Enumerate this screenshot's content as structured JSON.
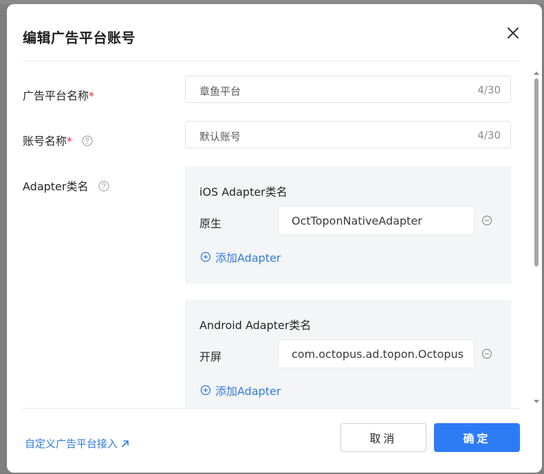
{
  "dialog": {
    "title": "编辑广告平台账号"
  },
  "form": {
    "platform_name": {
      "label": "广告平台名称",
      "required_mark": "*",
      "value": "章鱼平台",
      "counter": "4/30"
    },
    "account_name": {
      "label": "账号名称",
      "required_mark": "*",
      "value": "默认账号",
      "counter": "4/30"
    },
    "adapter": {
      "label": "Adapter类名"
    }
  },
  "ios_panel": {
    "title": "iOS Adapter类名",
    "rows": [
      {
        "label": "原生",
        "value": "OctToponNativeAdapter"
      }
    ],
    "add_label": "添加Adapter"
  },
  "android_panel": {
    "title": "Android Adapter类名",
    "rows": [
      {
        "label": "开屏",
        "value": "com.octopus.ad.topon.OctopusAdapter"
      }
    ],
    "add_label": "添加Adapter"
  },
  "footer": {
    "custom_link": "自定义广告平台接入",
    "cancel_label": "取消",
    "ok_label": "确定"
  },
  "colors": {
    "primary": "#2d7cf6",
    "link": "#2f7be0",
    "required": "#f5222d",
    "panel_bg": "#f4f5f7"
  }
}
